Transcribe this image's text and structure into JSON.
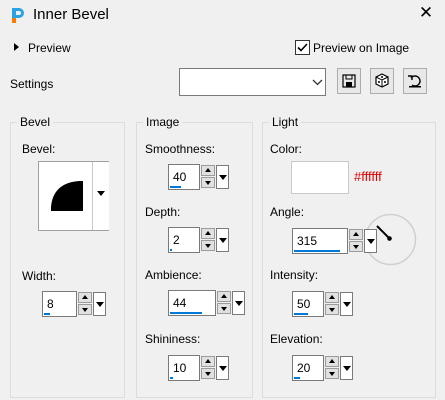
{
  "window": {
    "title": "Inner Bevel",
    "close_glyph": "✕",
    "icon": "paintshop-app-icon"
  },
  "preview": {
    "toggle_label": "Preview",
    "preview_on_image_label": "Preview on Image",
    "preview_on_image_checked": true
  },
  "settings": {
    "label": "Settings",
    "preset_value": "",
    "buttons": [
      "save-icon",
      "randomize-icon",
      "reset-icon"
    ]
  },
  "bevel": {
    "group_title": "Bevel",
    "bevel_label": "Bevel:",
    "width_label": "Width:",
    "width_value": "8"
  },
  "image": {
    "group_title": "Image",
    "smoothness_label": "Smoothness:",
    "smoothness_value": "40",
    "depth_label": "Depth:",
    "depth_value": "2",
    "ambience_label": "Ambience:",
    "ambience_value": "44",
    "shininess_label": "Shininess:",
    "shininess_value": "10"
  },
  "light": {
    "group_title": "Light",
    "color_label": "Color:",
    "color_value": "#ffffff",
    "color_hex_text": "#ffffff",
    "hex_text_color": "#e00000",
    "angle_label": "Angle:",
    "angle_value": "315",
    "intensity_label": "Intensity:",
    "intensity_value": "50",
    "elevation_label": "Elevation:",
    "elevation_value": "20"
  },
  "slider_levels": {
    "width": 0.2,
    "smoothness": 0.4,
    "depth": 0.04,
    "ambience": 0.72,
    "shininess": 0.1,
    "angle": 0.875,
    "intensity": 0.5,
    "elevation": 0.22
  },
  "accent_color": "#0078d7"
}
